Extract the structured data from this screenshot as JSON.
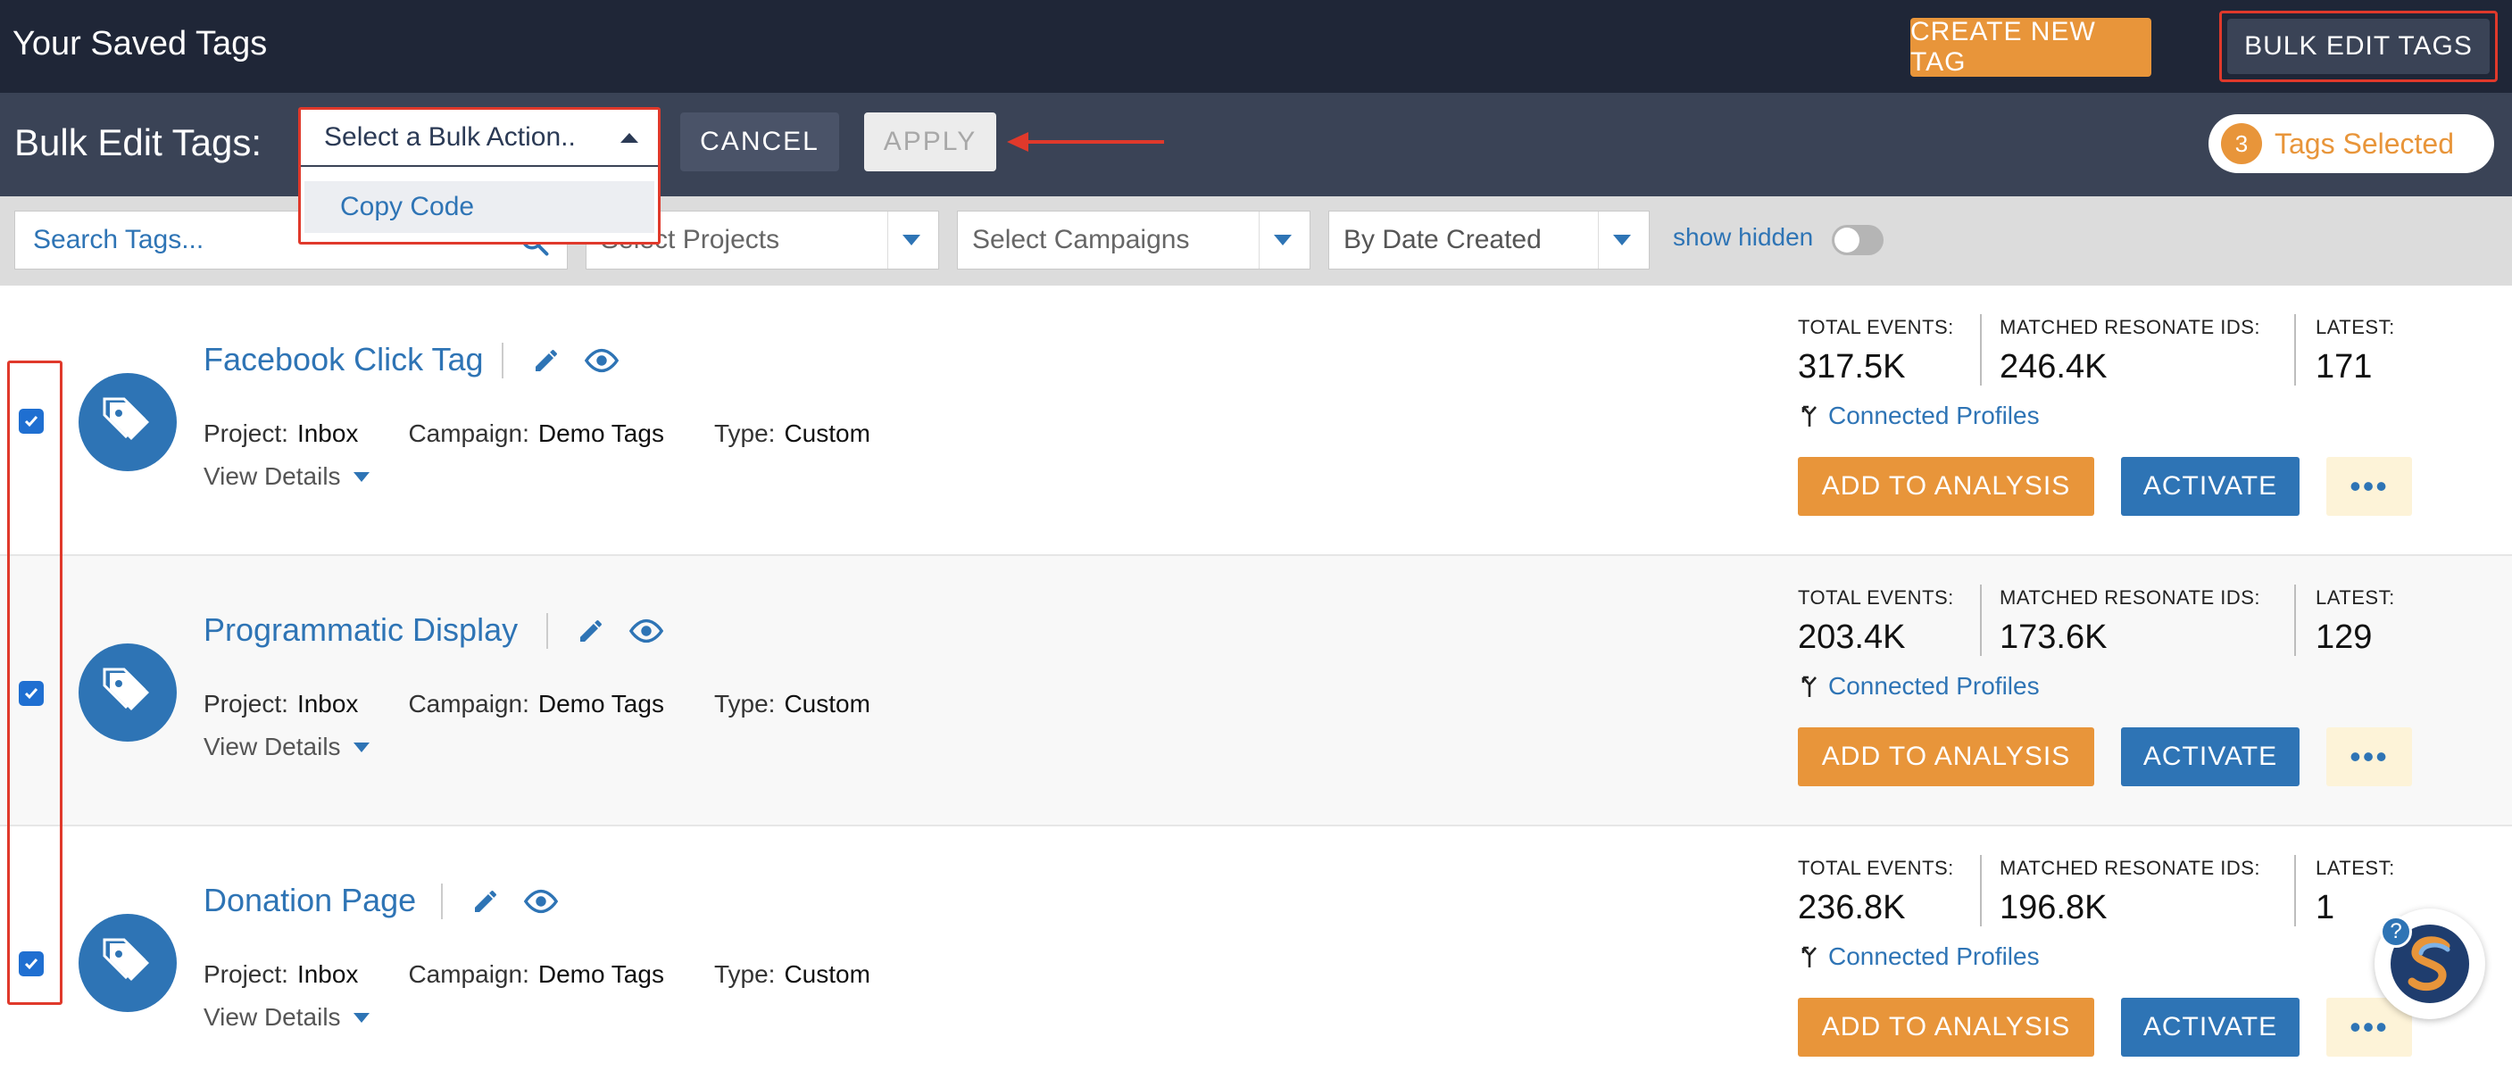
{
  "header": {
    "title": "Your Saved Tags",
    "create_label": "CREATE NEW TAG",
    "bulk_edit_label": "BULK EDIT TAGS"
  },
  "bulk_bar": {
    "label": "Bulk Edit Tags:",
    "select_value": "Select a Bulk Action..",
    "options": [
      "Copy Code"
    ],
    "cancel_label": "CANCEL",
    "apply_label": "APPLY",
    "selected_count": "3",
    "selected_text": "Tags Selected"
  },
  "filters": {
    "search_placeholder": "Search Tags...",
    "projects": "Select Projects",
    "campaigns": "Select Campaigns",
    "sort": "By Date Created",
    "show_hidden_label": "show hidden",
    "show_hidden": false
  },
  "labels": {
    "project": "Project:",
    "campaign": "Campaign:",
    "type": "Type:",
    "view_details": "View Details",
    "total_events": "TOTAL EVENTS:",
    "matched_ids": "MATCHED RESONATE IDS:",
    "latest": "LATEST:",
    "connected_profiles": "Connected Profiles",
    "add_to_analysis": "ADD TO ANALYSIS",
    "activate": "ACTIVATE",
    "more": "•••"
  },
  "tags": [
    {
      "name": "Facebook Click Tag",
      "project": "Inbox",
      "campaign": "Demo Tags",
      "type": "Custom",
      "total_events": "317.5K",
      "matched_ids": "246.4K",
      "latest": "171",
      "checked": true
    },
    {
      "name": "Programmatic Display",
      "project": "Inbox",
      "campaign": "Demo Tags",
      "type": "Custom",
      "total_events": "203.4K",
      "matched_ids": "173.6K",
      "latest": "129",
      "checked": true
    },
    {
      "name": "Donation Page",
      "project": "Inbox",
      "campaign": "Demo Tags",
      "type": "Custom",
      "total_events": "236.8K",
      "matched_ids": "196.8K",
      "latest": "1",
      "checked": true
    }
  ],
  "colors": {
    "header_bg": "#1f2637",
    "bar_bg": "#3a4356",
    "accent_orange": "#e8953a",
    "accent_blue": "#2e74b5",
    "highlight_red": "#e0392b"
  }
}
